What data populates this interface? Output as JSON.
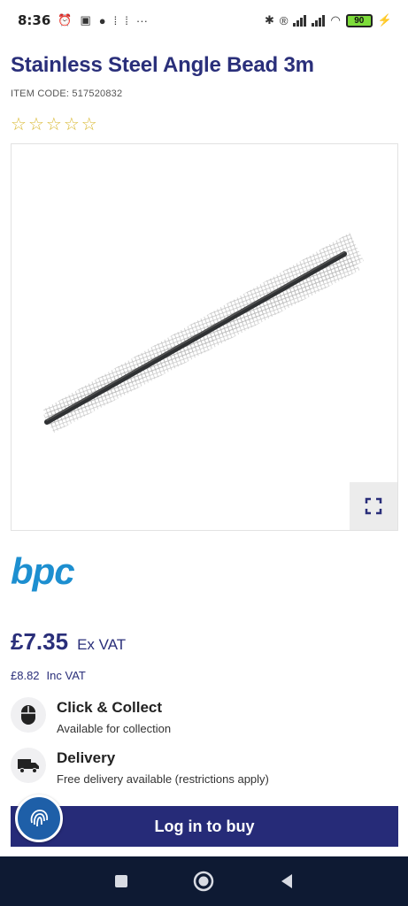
{
  "status_bar": {
    "time": "8:36",
    "battery": "90"
  },
  "product": {
    "title": "Stainless Steel Angle Bead 3m",
    "item_code": "ITEM CODE: 517520832",
    "rating_stars": 0,
    "brand": "bpc"
  },
  "pricing": {
    "price_ex": "£7.35",
    "ex_label": "Ex VAT",
    "price_inc": "£8.82",
    "inc_label": "Inc VAT"
  },
  "services": {
    "collect_title": "Click & Collect",
    "collect_sub": "Available for collection",
    "delivery_title": "Delivery",
    "delivery_sub": "Free delivery available (restrictions apply)"
  },
  "actions": {
    "buy_label": "Log in to buy"
  },
  "colors": {
    "primary": "#262b78",
    "brand_blue": "#1d8fd0",
    "star": "#d9b830",
    "nav_bar": "#0e1a33"
  },
  "icons": {
    "expand": "expand-icon",
    "collect": "mouse-icon",
    "delivery": "truck-icon",
    "chat": "fingerprint-icon",
    "nav_recents": "square-icon",
    "nav_home": "circle-icon",
    "nav_back": "triangle-back-icon"
  }
}
